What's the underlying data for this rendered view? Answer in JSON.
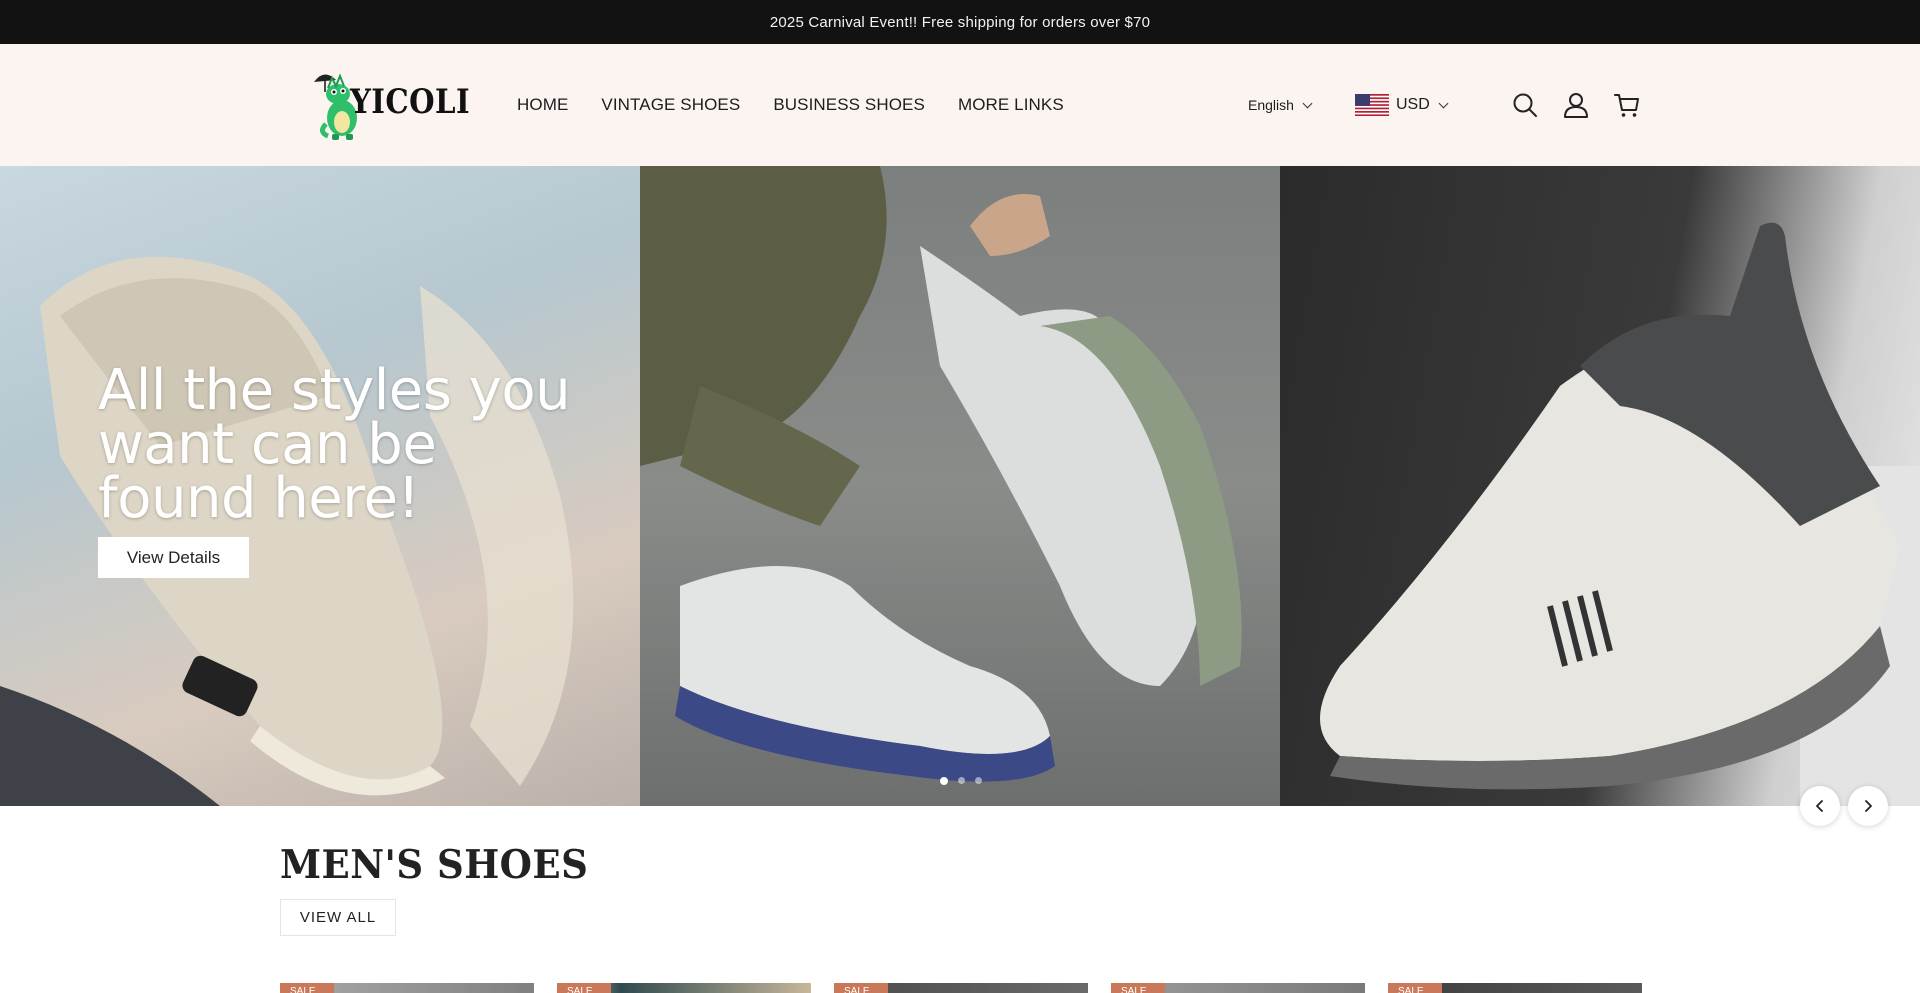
{
  "announcement": {
    "text": "2025 Carnival Event!! Free shipping for orders over $70"
  },
  "header": {
    "logo_text": "YICOLI",
    "nav": [
      {
        "label": "HOME"
      },
      {
        "label": "VINTAGE SHOES"
      },
      {
        "label": "BUSINESS SHOES"
      },
      {
        "label": "MORE LINKS"
      }
    ],
    "language": "English",
    "currency": "USD",
    "icons": [
      "search-icon",
      "account-icon",
      "cart-icon"
    ]
  },
  "hero": {
    "title": "All the styles you want can be found here!",
    "button_label": "View Details",
    "slides": 3,
    "active_slide": 1
  },
  "section": {
    "title": "MEN'S SHOES",
    "view_all_label": "VIEW ALL",
    "products": [
      {
        "badge": "SALE"
      },
      {
        "badge": "SALE"
      },
      {
        "badge": "SALE"
      },
      {
        "badge": "SALE"
      },
      {
        "badge": "SALE"
      }
    ]
  },
  "colors": {
    "announcement_bg": "#121212",
    "header_bg": "#fbf4f1",
    "sale_badge": "#c9795a",
    "logo_green": "#2fbf6a"
  }
}
